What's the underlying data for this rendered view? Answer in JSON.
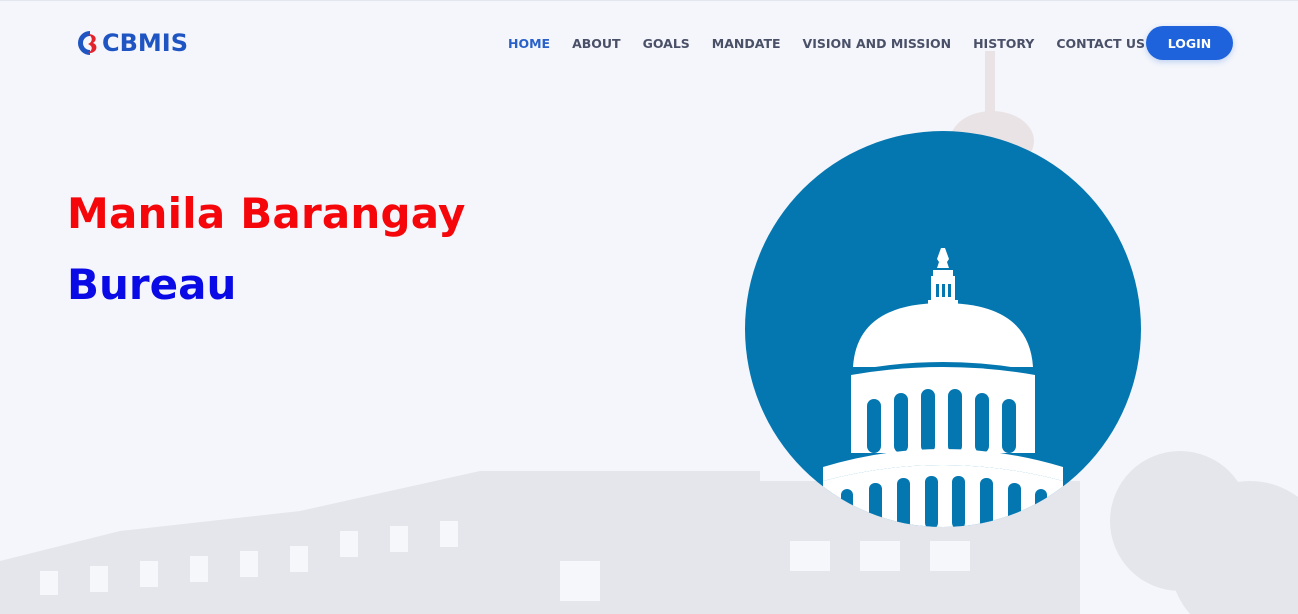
{
  "brand": {
    "name": "CBMIS",
    "logo_icon": "cbmis-logo-icon"
  },
  "nav": {
    "items": [
      {
        "label": "HOME",
        "active": true
      },
      {
        "label": "ABOUT",
        "active": false
      },
      {
        "label": "GOALS",
        "active": false
      },
      {
        "label": "MANDATE",
        "active": false
      },
      {
        "label": "VISION AND MISSION",
        "active": false
      },
      {
        "label": "HISTORY",
        "active": false
      },
      {
        "label": "CONTACT US",
        "active": false
      }
    ],
    "login_label": "LOGIN"
  },
  "hero": {
    "line1": "Manila Barangay",
    "line2": "Bureau",
    "illustration": "capitol-building-icon"
  },
  "colors": {
    "accent": "#1e63dc",
    "nav_active": "#2a61c8",
    "nav_text": "#4a5067",
    "title_red": "#f4060a",
    "title_blue": "#0a0ae6",
    "circle": "#0577b0",
    "background": "#f4f6fb"
  }
}
